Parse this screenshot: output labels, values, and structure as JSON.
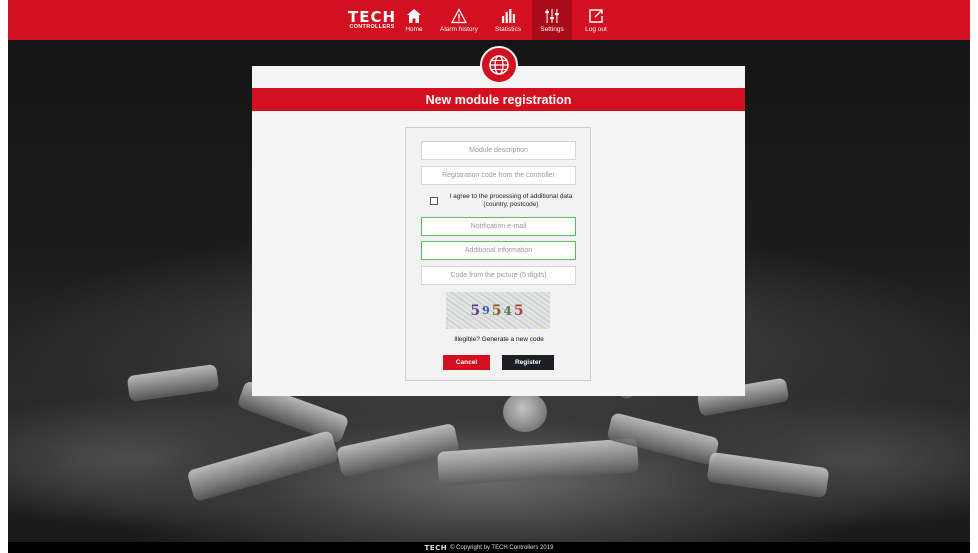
{
  "nav": {
    "logo_line1": "TECH",
    "logo_line2": "CONTROLLERS",
    "items": [
      {
        "label": "Home",
        "icon": "home-icon"
      },
      {
        "label": "Alarm history",
        "icon": "warning-icon"
      },
      {
        "label": "Statistics",
        "icon": "bar-chart-icon"
      },
      {
        "label": "Settings",
        "icon": "sliders-icon",
        "active": true
      },
      {
        "label": "Log out",
        "icon": "logout-icon"
      }
    ]
  },
  "dialog": {
    "title": "New module registration",
    "badge_icon": "globe-icon",
    "fields": {
      "module_description": "Module description",
      "registration_code": "Registration code from the controller",
      "notification_email": "Notification e-mail",
      "additional_information": "Additional information",
      "captcha_code": "Code from the picture (5 digits)"
    },
    "consent_label": "I agree to the processing of additional data (country, postcode)",
    "captcha_digits": [
      "5",
      "9",
      "5",
      "4",
      "5"
    ],
    "new_code_link": "Illegible? Generate a new code",
    "cancel_label": "Cancel",
    "register_label": "Register"
  },
  "footer": {
    "logo": "TECH",
    "text": "© Copyright by TECH Controllers 2019"
  },
  "colors": {
    "brand_red": "#d2101f",
    "dark_button": "#1c1f26",
    "valid_border": "#5cb85c"
  }
}
